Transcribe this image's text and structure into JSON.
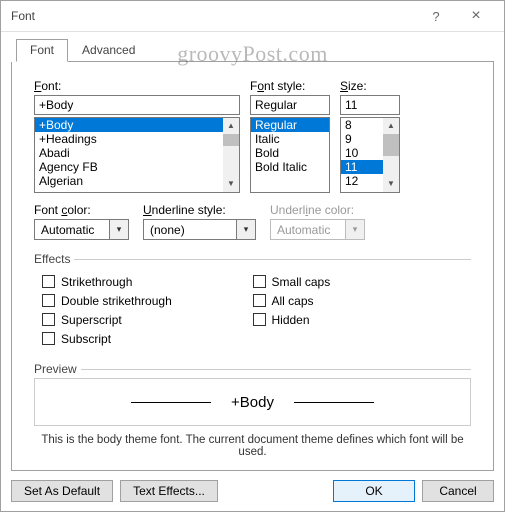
{
  "window": {
    "title": "Font",
    "help_icon": "?",
    "close_icon": "×"
  },
  "watermark": "groovyPost.com",
  "tabs": {
    "font": "Font",
    "advanced": "Advanced"
  },
  "font_section": {
    "label": "Font:",
    "value": "+Body",
    "items": [
      "+Body",
      "+Headings",
      "Abadi",
      "Agency FB",
      "Algerian"
    ],
    "selected_index": 0
  },
  "style_section": {
    "label": "Font style:",
    "value": "Regular",
    "items": [
      "Regular",
      "Italic",
      "Bold",
      "Bold Italic"
    ],
    "selected_index": 0
  },
  "size_section": {
    "label": "Size:",
    "value": "11",
    "items": [
      "8",
      "9",
      "10",
      "11",
      "12"
    ],
    "selected_index": 3
  },
  "font_color": {
    "label": "Font color:",
    "value": "Automatic"
  },
  "underline_style": {
    "label": "Underline style:",
    "value": "(none)"
  },
  "underline_color": {
    "label": "Underline color:",
    "value": "Automatic"
  },
  "effects": {
    "title": "Effects",
    "strikethrough": "Strikethrough",
    "double_strikethrough": "Double strikethrough",
    "superscript": "Superscript",
    "subscript": "Subscript",
    "small_caps": "Small caps",
    "all_caps": "All caps",
    "hidden": "Hidden"
  },
  "preview": {
    "title": "Preview",
    "sample": "+Body",
    "hint": "This is the body theme font. The current document theme defines which font will be used."
  },
  "buttons": {
    "set_default": "Set As Default",
    "text_effects": "Text Effects...",
    "ok": "OK",
    "cancel": "Cancel"
  }
}
